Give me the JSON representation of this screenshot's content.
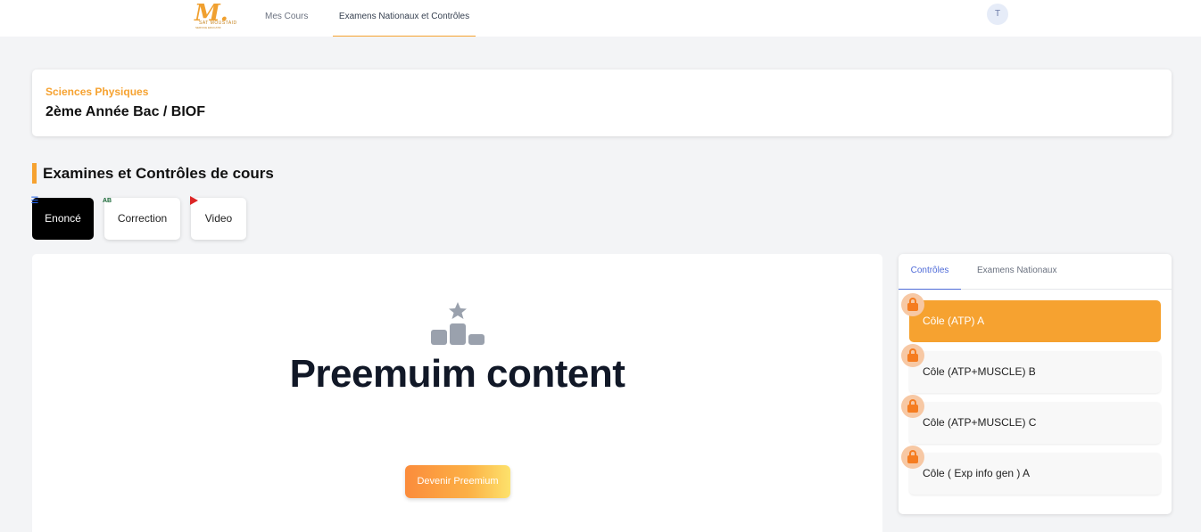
{
  "nav": {
    "logo_text": "M.",
    "logo_sub": "SAT MOUSTAID",
    "logo_tagline": "SERVICE EDUCATIF",
    "mes_cours": "Mes Cours",
    "examens": "Examens Nationaux et Contrôles",
    "avatar_initial": "T"
  },
  "header": {
    "subject": "Sciences Physiques",
    "level": "2ème Année Bac / BIOF"
  },
  "section": {
    "title": "Examines et Contrôles de cours"
  },
  "content_tabs": [
    {
      "label": "Enoncé",
      "icon": "list-icon",
      "active": true
    },
    {
      "label": "Correction",
      "icon": "spellcheck-icon",
      "icon_text": "AB",
      "active": false
    },
    {
      "label": "Video",
      "icon": "play-icon",
      "active": false
    }
  ],
  "main": {
    "icon": "podium-star-icon",
    "title": "Preemuim content",
    "button_label": "Devenir Preemium"
  },
  "sidebar": {
    "tabs": [
      {
        "label": "Contrôles",
        "active": true
      },
      {
        "label": "Examens Nationaux",
        "active": false
      }
    ],
    "items": [
      {
        "label": "Côle (ATP) A",
        "locked": true,
        "active": true
      },
      {
        "label": "Côle (ATP+MUSCLE) B",
        "locked": true,
        "active": false
      },
      {
        "label": "Côle (ATP+MUSCLE) C",
        "locked": true,
        "active": false
      },
      {
        "label": "Côle ( Exp info gen ) A",
        "locked": true,
        "active": false
      }
    ]
  },
  "colors": {
    "accent_orange": "#f6a230",
    "tab_active_blue": "#4f6bd8",
    "lock_orange": "#f57c20",
    "active_tab_bg": "#000000"
  }
}
